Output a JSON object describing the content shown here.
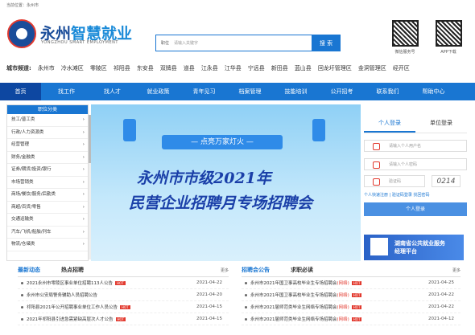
{
  "breadcrumb": "当前位置：永州市",
  "brand": {
    "name_part1": "永州",
    "name_part2": "智慧就业",
    "subtitle": "YONGZHOU SMART EMPLOYMENT"
  },
  "search": {
    "position_label": "职位",
    "placeholder": "请输入关键字",
    "button": "搜 索"
  },
  "qr": [
    {
      "label": "微信服务号"
    },
    {
      "label": "APP下载"
    }
  ],
  "cities": {
    "label": "城市频道:",
    "items": [
      "永州市",
      "冷水滩区",
      "零陵区",
      "祁阳县",
      "东安县",
      "双牌县",
      "道县",
      "江永县",
      "江华县",
      "宁远县",
      "新田县",
      "蓝山县",
      "回龙圩管理区",
      "金洞管理区",
      "经开区"
    ]
  },
  "nav": [
    "首页",
    "找工作",
    "找人才",
    "就业政策",
    "青年见习",
    "档案管理",
    "技能培训",
    "公开招考",
    "联系我们",
    "帮助中心"
  ],
  "sidebar": {
    "title": "职位分类",
    "items": [
      "技工/普工类",
      "行政/人力资源类",
      "经营管理",
      "财务/金融类",
      "证券/期货/投资/银行",
      "市场营销类",
      "商场/餐饮/服务/后勤类",
      "商超/百货/零售",
      "交通运输类",
      "汽车/飞机/船舶/列车",
      "物流/仓储类"
    ]
  },
  "banner": {
    "slogan": "— 点亮万家灯火 —",
    "title1": "永州市市级2021年",
    "title2": "民营企业招聘月专场招聘会"
  },
  "login": {
    "tab_personal": "个人登录",
    "tab_company": "单位登录",
    "username_placeholder": "请输入个人用户名",
    "password_placeholder": "请输入个人密码",
    "captcha_placeholder": "验证码",
    "captcha_code": "0214",
    "links": "个人快速注册 | 验证码登录   找回密码",
    "button": "个人登录"
  },
  "promo": {
    "line1": "湖南省公共就业服务",
    "line2": "经理平台"
  },
  "news_panel": {
    "tab1": "最新动态",
    "tab2": "热点招聘",
    "more": "更多",
    "items": [
      {
        "title": "2021永州市零陵区事业单位招聘113人公告",
        "date": "2021-04-22",
        "hot": "HOT"
      },
      {
        "title": "永州市公安局警务辅助人员招聘公告",
        "date": "2021-04-20",
        "hot": ""
      },
      {
        "title": "祁阳县2021年公开招聘事业单位工作人员公告",
        "date": "2021-04-15",
        "hot": "HOT"
      },
      {
        "title": "2021年祁阳县引进急需紧缺高层次人才公告",
        "date": "2021-04-15",
        "hot": "HOT"
      }
    ]
  },
  "recruit_panel": {
    "tab1": "招聘会公告",
    "tab2": "求职必读",
    "more": "更多",
    "items": [
      {
        "title": "永州市2021年国卫事高校毕业生专场招聘会",
        "tag": "(网络)",
        "date": "2021-04-25",
        "hot": "HOT"
      },
      {
        "title": "永州市2021年国卫事高校毕业生专场招聘会",
        "tag": "(网络)",
        "date": "2021-04-22",
        "hot": "HOT"
      },
      {
        "title": "永州市2021届师范类毕业生网络专场招聘会",
        "tag": "(网络)",
        "date": "2021-04-22",
        "hot": "HOT"
      },
      {
        "title": "永州市2021届师范类毕业生网络专场招聘会",
        "tag": "(网络)",
        "date": "2021-04-12",
        "hot": "HOT"
      }
    ]
  }
}
